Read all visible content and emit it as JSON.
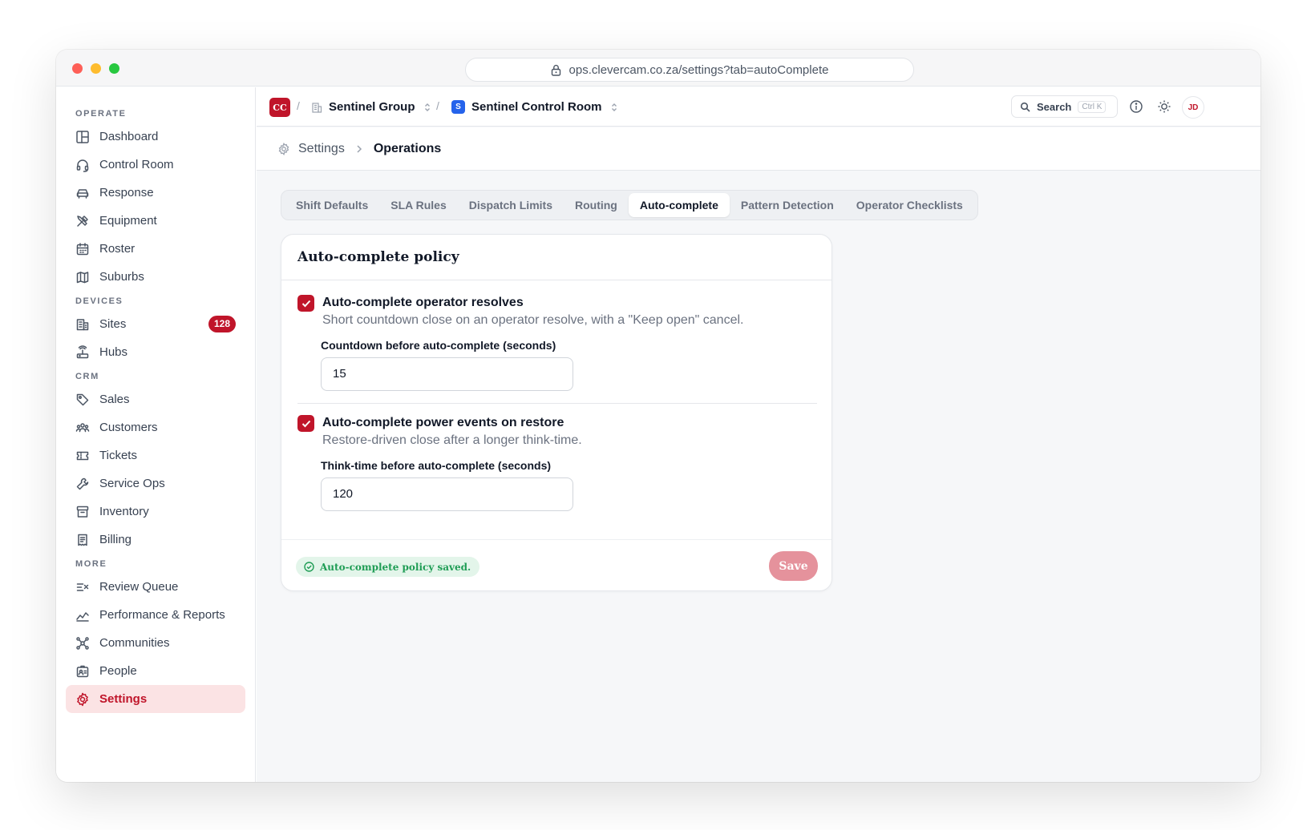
{
  "browser": {
    "url": "ops.clevercam.co.za/settings?tab=autoComplete"
  },
  "sidebar": {
    "groups": [
      {
        "label": "OPERATE",
        "items": [
          {
            "label": "Dashboard",
            "icon": "layout-icon"
          },
          {
            "label": "Control Room",
            "icon": "headset-icon"
          },
          {
            "label": "Response",
            "icon": "car-icon"
          },
          {
            "label": "Equipment",
            "icon": "tools-icon"
          },
          {
            "label": "Roster",
            "icon": "calendar-icon"
          },
          {
            "label": "Suburbs",
            "icon": "map-icon"
          }
        ]
      },
      {
        "label": "DEVICES",
        "items": [
          {
            "label": "Sites",
            "icon": "building-icon",
            "badge": "128"
          },
          {
            "label": "Hubs",
            "icon": "router-icon"
          }
        ]
      },
      {
        "label": "CRM",
        "items": [
          {
            "label": "Sales",
            "icon": "tag-icon"
          },
          {
            "label": "Customers",
            "icon": "users-icon"
          },
          {
            "label": "Tickets",
            "icon": "ticket-icon"
          },
          {
            "label": "Service Ops",
            "icon": "wrench-icon"
          },
          {
            "label": "Inventory",
            "icon": "archive-icon"
          },
          {
            "label": "Billing",
            "icon": "receipt-icon"
          }
        ]
      },
      {
        "label": "MORE",
        "items": [
          {
            "label": "Review Queue",
            "icon": "list-check-icon"
          },
          {
            "label": "Performance & Reports",
            "icon": "trend-icon"
          },
          {
            "label": "Communities",
            "icon": "network-icon"
          },
          {
            "label": "People",
            "icon": "id-badge-icon"
          },
          {
            "label": "Settings",
            "icon": "gear-icon",
            "active": true
          }
        ]
      }
    ]
  },
  "topbar": {
    "org_logo": "CC",
    "org_name": "Sentinel Group",
    "site_logo": "S",
    "site_name": "Sentinel Control Room",
    "search_label": "Search",
    "search_shortcut": "Ctrl K",
    "avatar_initials": "JD"
  },
  "breadcrumb": {
    "root": "Settings",
    "current": "Operations"
  },
  "tabs": [
    "Shift Defaults",
    "SLA Rules",
    "Dispatch Limits",
    "Routing",
    "Auto-complete",
    "Pattern Detection",
    "Operator Checklists"
  ],
  "active_tab": "Auto-complete",
  "card": {
    "title": "Auto-complete policy",
    "options": [
      {
        "label": "Auto-complete operator resolves",
        "checked": true,
        "description": "Short countdown close on an operator resolve, with a \"Keep open\" cancel.",
        "field_label": "Countdown before auto-complete (seconds)",
        "field_value": "15"
      },
      {
        "label": "Auto-complete power events on restore",
        "checked": true,
        "description": "Restore-driven close after a longer think-time.",
        "field_label": "Think-time before auto-complete (seconds)",
        "field_value": "120"
      }
    ],
    "status": "Auto-complete policy saved.",
    "save_label": "Save"
  },
  "colors": {
    "accent": "#c0152a",
    "accent_soft": "#fbe3e4",
    "save_disabled": "#e5929c",
    "success": "#1f9d55",
    "success_bg": "#e3f5ea"
  }
}
